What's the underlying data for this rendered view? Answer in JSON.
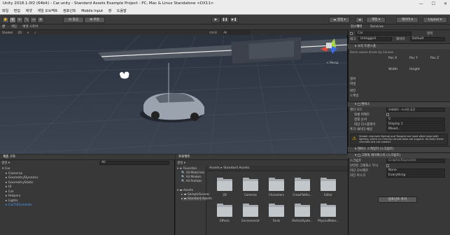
{
  "window": {
    "title": "Unity 2018.1.0f2 (64bit) - Car.unity - Standard Assets Example Project - PC, Mac & Linux Standalone <DX11>"
  },
  "menu": [
    "파일",
    "편집",
    "애셋",
    "게임 오브젝트",
    "컴포넌트",
    "Mobile Input",
    "창",
    "도움말"
  ],
  "toolbar": {
    "pivot": "중심",
    "local": "로컬",
    "collab": "협업",
    "account": "계정",
    "layers": "레이어",
    "layout": "Layout"
  },
  "scene": {
    "tabs": [
      "씬",
      "게임",
      "애셋 스토어"
    ],
    "shading": "Shaded",
    "mode": "2D",
    "gizmos": "기즈모",
    "search_placeholder": "All",
    "persp": "< Persp"
  },
  "inspector": {
    "tabs": [
      "인스펙터",
      "Services"
    ],
    "object_name": "Car",
    "static_label": "정적",
    "tag_label": "태그",
    "tag_value": "Untagged",
    "layer_label": "레이어",
    "layer_value": "Default",
    "section_transform": "사각 트랜스폼",
    "transform_note": "Some values driven by Canvas.",
    "pos_labels": [
      "Pos X",
      "Pos Y",
      "Pos Z"
    ],
    "wh_labels": [
      "Width",
      "Height"
    ],
    "anchors": "앵커",
    "pivot": "피벗",
    "rotation": "회전",
    "scale": "스케일",
    "section_canvas": "캔버스",
    "render_mode_label": "렌더 모드",
    "render_mode_value": "오버레이 - 스크린 공간",
    "pixel_perfect": "픽셀 퍼펙트",
    "sort_order_label": "정렬 순서",
    "sort_order_value": "0",
    "target_display_label": "대상 디스플레이",
    "target_display_value": "Display 1",
    "additional_label": "추가 셰이더 채널",
    "additional_value": "Mixed...",
    "warning": "Shader channels Normal and Tangent are most often used with lighting, which an Overlay canvas does not support. Its likely these channels are not needed.",
    "section_scaler": "캔버스 스케일러 (스크립트)",
    "ui_scale_label": "UI 스케일 모드",
    "ui_scale_value": "상수 픽셀 크기",
    "scale_factor_label": "스케일 팩터",
    "ref_ppu_label": "참조 PPU",
    "section_raycaster": "그래픽 레이캐스터 (스크립트)",
    "script_label": "스크립트",
    "script_value": "GraphicRaycaster",
    "ignore_label": "반전된 그래픽스 무시",
    "blocking_objects_label": "차단 오브젝트",
    "blocking_objects_value": "None",
    "blocking_mask_label": "차단 마스크",
    "blocking_mask_value": "Everything",
    "add_component": "컴포넌트 추가"
  },
  "hierarchy": {
    "tab": "계층 구조",
    "create": "생성",
    "search_placeholder": "All",
    "items": [
      {
        "label": "Car",
        "indent": 0,
        "selected": false,
        "expanded": true
      },
      {
        "label": "Cameras",
        "indent": 1,
        "selected": false,
        "expanded": false
      },
      {
        "label": "GeometryDynamic",
        "indent": 1,
        "selected": false,
        "expanded": false
      },
      {
        "label": "GeometryStatic",
        "indent": 1,
        "selected": false,
        "expanded": false
      },
      {
        "label": "UI",
        "indent": 1,
        "selected": false,
        "expanded": false
      },
      {
        "label": "Car",
        "indent": 1,
        "selected": false,
        "expanded": false
      },
      {
        "label": "Helpers",
        "indent": 1,
        "selected": false,
        "expanded": false
      },
      {
        "label": "Lights",
        "indent": 1,
        "selected": false,
        "expanded": false
      },
      {
        "label": "CarTiltControls",
        "indent": 1,
        "selected": true,
        "expanded": false
      }
    ]
  },
  "project": {
    "tab": "프로젝트",
    "create": "생성",
    "favorites": [
      "Favorites",
      "All Materials",
      "All Models",
      "All Prefabs"
    ],
    "assets": [
      "Assets",
      "SampleScenes",
      "Standard Assets"
    ],
    "breadcrumb": "Assets ▸ Standard Assets",
    "folders": [
      "2D",
      "Cameras",
      "Characters",
      "CrossPlatfor...",
      "Editor",
      "Effects",
      "Environment",
      "Fonts",
      "ParticleSyste...",
      "PhysicsMater..."
    ]
  }
}
